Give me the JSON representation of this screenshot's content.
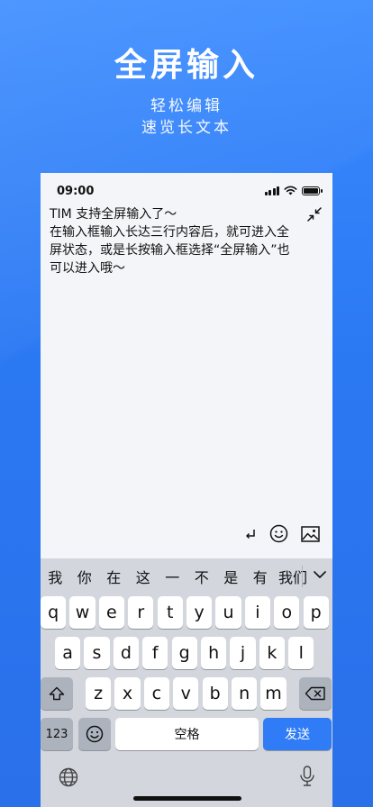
{
  "hero": {
    "title": "全屏输入",
    "subtitle_line1": "轻松编辑",
    "subtitle_line2": "速览长文本"
  },
  "status_bar": {
    "time": "09:00"
  },
  "compose": {
    "line1": "TIM 支持全屏输入了～",
    "line2": "在输入框输入长达三行内容后，就可进入全屏状态，或是长按输入框选择“全屏输入”也可以进入哦～"
  },
  "candidates": [
    "我",
    "你",
    "在",
    "这",
    "一",
    "不",
    "是",
    "有",
    "我们"
  ],
  "keyboard": {
    "row1": [
      "q",
      "w",
      "e",
      "r",
      "t",
      "y",
      "u",
      "i",
      "o",
      "p"
    ],
    "row2": [
      "a",
      "s",
      "d",
      "f",
      "g",
      "h",
      "j",
      "k",
      "l"
    ],
    "row3": [
      "z",
      "x",
      "c",
      "v",
      "b",
      "n",
      "m"
    ],
    "numbers_label": "123",
    "space_label": "空格",
    "send_label": "发送"
  },
  "colors": {
    "brand_blue": "#2f7cf6",
    "keyboard_bg": "#d3d6dd",
    "dark_key": "#adb3bd"
  }
}
